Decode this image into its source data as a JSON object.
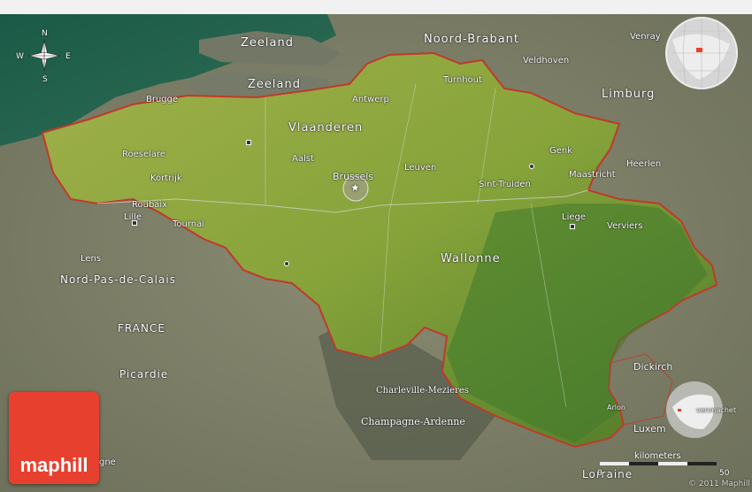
{
  "map": {
    "regions_belgium": [
      "Vlaanderen",
      "Wallonne"
    ],
    "capital": "Brussels",
    "labels": {
      "zeeland_1": "Zeeland",
      "zeeland_2": "Zeeland",
      "noord_brabant": "Noord-Brabant",
      "venray": "Venray",
      "veldhoven": "Veldhoven",
      "turnhout": "Turnhout",
      "limburg": "Limburg",
      "brugge": "Brugge",
      "antwerp": "Antwerp",
      "vlaanderen": "Vlaanderen",
      "genk": "Genk",
      "heerlen": "Heerlen",
      "roeselare": "Roeselare",
      "aalst": "Aalst",
      "brussels": "Brussels",
      "leuven": "Leuven",
      "kortrijk": "Kortrijk",
      "maastricht": "Maastricht",
      "sint_truiden": "Sint-Truiden",
      "roubaix": "Roubaix",
      "lille": "Lille",
      "tournai": "Tournai",
      "liege": "Liege",
      "verviers": "Verviers",
      "lens": "Lens",
      "wallonne": "Wallonne",
      "nord_pas_de_calais": "Nord-Pas-de-Calais",
      "france": "FRANCE",
      "picardie": "Picardie",
      "dickirch": "Dickirch",
      "charleville": "Charleville-Mezieres",
      "arlon": "Arlon",
      "champagne": "Champagne-Ardenne",
      "luxem": "Luxem",
      "venmachet": "venmachet",
      "lorraine": "Lorraine",
      "gne": "gne"
    },
    "compass": {
      "n": "N",
      "s": "S",
      "e": "E",
      "w": "W"
    },
    "scale": {
      "label": "kilometers",
      "tick_0": "0",
      "tick_50": "50"
    },
    "copyright": "© 2011 Maphill",
    "brand": "maphill",
    "colors": {
      "sea": "#1f5d46",
      "belgium_green": "#8aa83a",
      "border": "#c0392b",
      "logo": "#e8402f"
    }
  }
}
